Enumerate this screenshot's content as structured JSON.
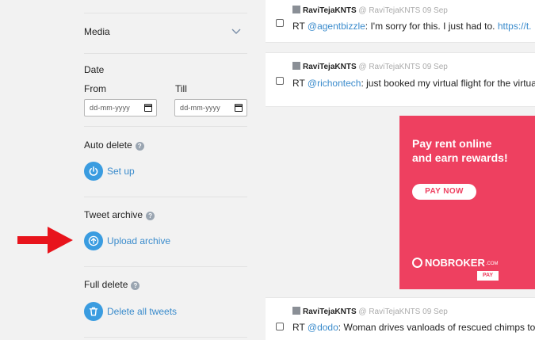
{
  "sidebar": {
    "media_label": "Media",
    "date_label": "Date",
    "from_label": "From",
    "till_label": "Till",
    "date_placeholder": "dd-mm-yyyy",
    "auto_delete": {
      "title": "Auto delete",
      "action": "Set up"
    },
    "tweet_archive": {
      "title": "Tweet archive",
      "action": "Upload archive"
    },
    "full_delete": {
      "title": "Full delete",
      "action": "Delete all tweets"
    },
    "help_glyph": "?"
  },
  "tweets": [
    {
      "name": "RaviTejaKNTS",
      "handle": "@ RaviTejaKNTS 09 Sep",
      "prefix": "RT ",
      "mention": "@agentbizzle",
      "body": ": I'm sorry for this. I just had to. ",
      "link": "https://t."
    },
    {
      "name": "RaviTejaKNTS",
      "handle": "@ RaviTejaKNTS 09 Sep",
      "prefix": "RT ",
      "mention": "@richontech",
      "body": ": just booked my virtual flight for the virtual",
      "link": ""
    },
    {
      "name": "RaviTejaKNTS",
      "handle": "@ RaviTejaKNTS 09 Sep",
      "prefix": "RT ",
      "mention": "@dodo",
      "body": ": Woman drives vanloads of rescued chimps to",
      "link": ""
    }
  ],
  "ad": {
    "headline_line1": "Pay rent online",
    "headline_line2": "and earn rewards!",
    "cta": "PAY NOW",
    "brand": "NOBROKER",
    "brand_suffix": ".COM",
    "brand_tag": "PAY",
    "color": "#ee4060"
  },
  "colors": {
    "accent": "#3a9ce0",
    "link": "#3a8bcc",
    "arrow": "#e8141c"
  }
}
